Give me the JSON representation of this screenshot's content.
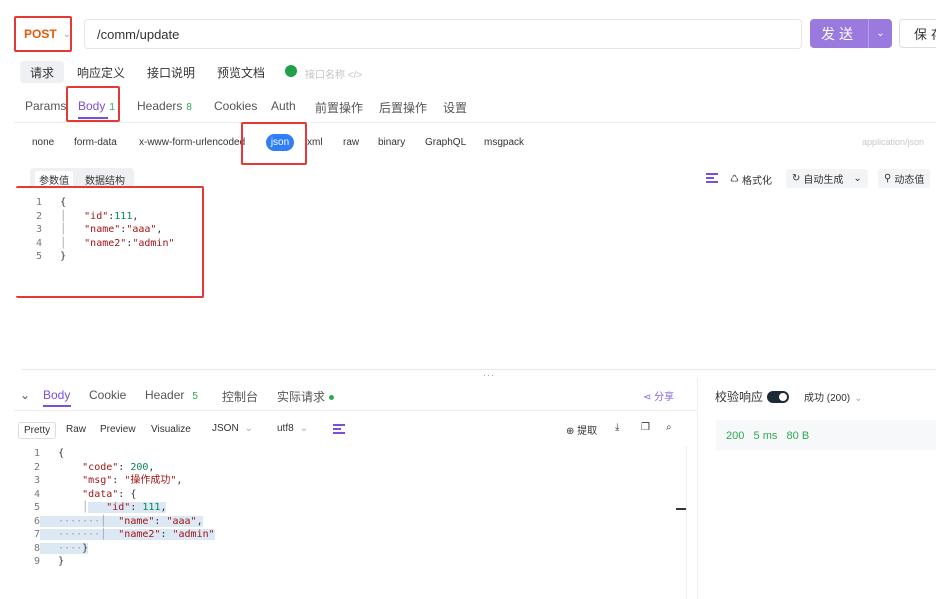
{
  "request": {
    "method": "POST",
    "url": "/comm/update",
    "send_label": "发送",
    "save_label": "保存"
  },
  "mode_tabs": [
    "请求",
    "响应定义",
    "接口说明",
    "预览文档"
  ],
  "interface_name_placeholder": "接口名称 </>",
  "param_tabs": [
    {
      "label": "Params"
    },
    {
      "label": "Body",
      "badge": "1"
    },
    {
      "label": "Headers",
      "badge": "8"
    },
    {
      "label": "Cookies"
    },
    {
      "label": "Auth"
    },
    {
      "label": "前置操作"
    },
    {
      "label": "后置操作"
    },
    {
      "label": "设置"
    }
  ],
  "body_types": [
    "none",
    "form-data",
    "x-www-form-urlencoded",
    "json",
    "xml",
    "raw",
    "binary",
    "GraphQL",
    "msgpack"
  ],
  "selected_body_type": "json",
  "content_type": "application/json",
  "sub_tabs": [
    "参数值",
    "数据结构"
  ],
  "editor_tools": {
    "format": "格式化",
    "auto_generate": "自动生成",
    "dynamic": "动态值"
  },
  "request_body_lines": [
    {
      "n": "1",
      "text": "{"
    },
    {
      "n": "2",
      "key": "\"id\"",
      "sep": ":",
      "val": "111",
      "tail": ","
    },
    {
      "n": "3",
      "key": "\"name\"",
      "sep": ":",
      "val": "\"aaa\"",
      "tail": ","
    },
    {
      "n": "4",
      "key": "\"name2\"",
      "sep": ":",
      "val": "\"admin\"",
      "tail": ""
    },
    {
      "n": "5",
      "text": "}"
    }
  ],
  "response": {
    "tabs": [
      {
        "label": "Body"
      },
      {
        "label": "Cookie"
      },
      {
        "label": "Header",
        "badge": "5"
      },
      {
        "label": "控制台"
      },
      {
        "label": "实际请求"
      }
    ],
    "share_label": "分享",
    "verify_label": "校验响应",
    "status_select": "成功 (200)",
    "view_modes": [
      "Pretty",
      "Raw",
      "Preview",
      "Visualize"
    ],
    "format_select": "JSON",
    "encoding_select": "utf8",
    "extract_label": "提取",
    "stats": {
      "code": "200",
      "time": "5 ms",
      "size": "80 B"
    },
    "body_lines": [
      {
        "n": "1",
        "text": "{"
      },
      {
        "n": "2",
        "key": "\"code\"",
        "val": "200",
        "tail": ","
      },
      {
        "n": "3",
        "key": "\"msg\"",
        "val": "\"操作成功\"",
        "tail": ","
      },
      {
        "n": "4",
        "key": "\"data\"",
        "val": "{",
        "tail": ""
      },
      {
        "n": "5",
        "key": "\"id\"",
        "val": "111",
        "tail": ","
      },
      {
        "n": "6",
        "key": "\"name\"",
        "val": "\"aaa\"",
        "tail": ","
      },
      {
        "n": "7",
        "key": "\"name2\"",
        "val": "\"admin\"",
        "tail": ""
      },
      {
        "n": "8",
        "text": "}"
      },
      {
        "n": "9",
        "text": "}"
      }
    ]
  }
}
